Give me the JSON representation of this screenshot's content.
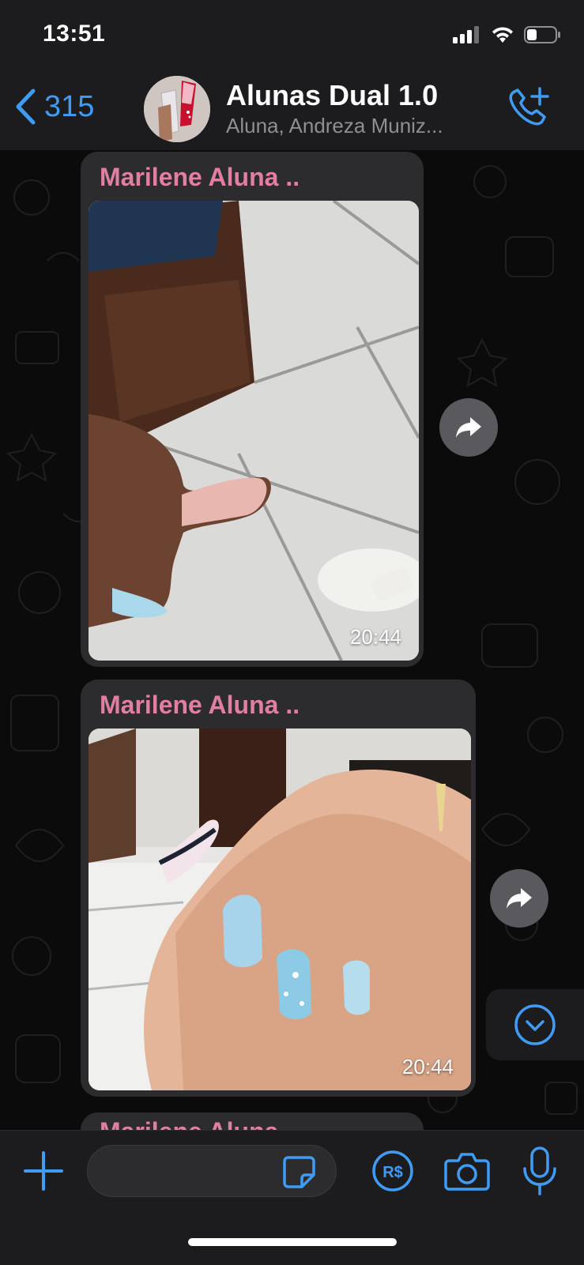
{
  "status": {
    "time": "13:51"
  },
  "header": {
    "back_count": "315",
    "title": "Alunas Dual 1.0",
    "subtitle": "Aluna, Andreza Muniz..."
  },
  "messages": [
    {
      "sender": "Marilene Aluna ..",
      "time": "20:44"
    },
    {
      "sender": "Marilene Aluna ..",
      "time": "20:44"
    },
    {
      "sender": "Marilene Aluna .."
    }
  ],
  "input": {
    "value": "",
    "placeholder": ""
  },
  "colors": {
    "accent": "#3f9cf5",
    "sender_name": "#e17fa0",
    "bubble": "#2c2c2e",
    "bar": "#1c1c1e"
  }
}
